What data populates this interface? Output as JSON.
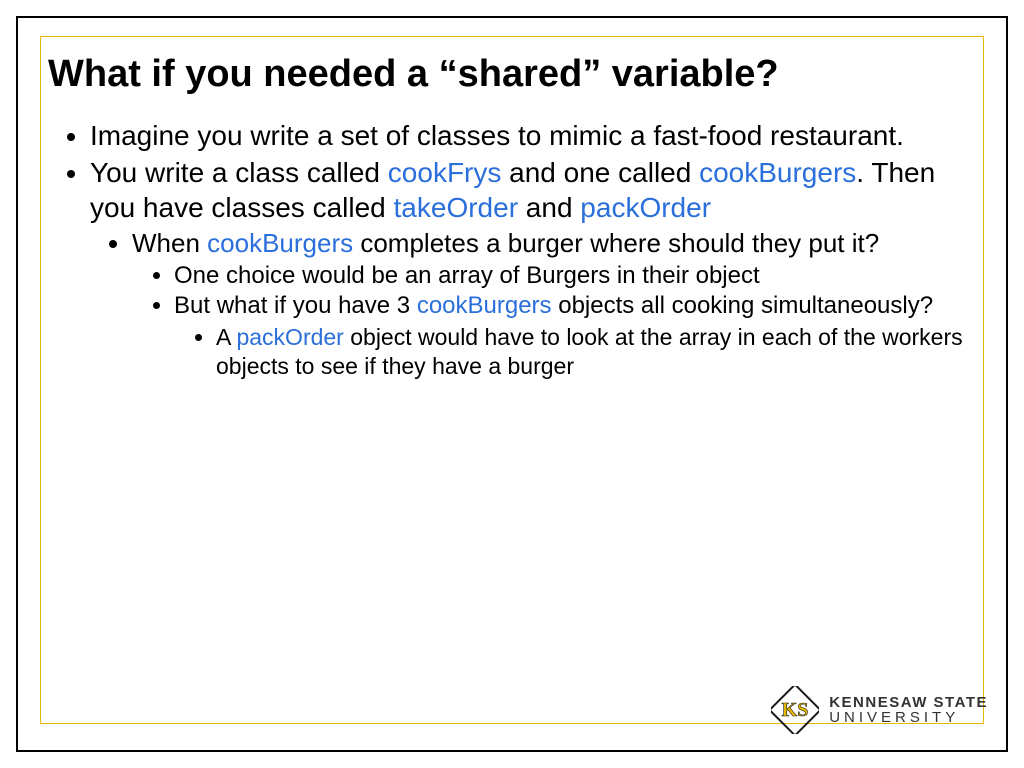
{
  "title": "What if you needed a “shared” variable?",
  "colors": {
    "keyword": "#2a6fdb",
    "accentBorder": "#e6b800"
  },
  "bullets": {
    "b1": "Imagine you write a set of classes to mimic a fast-food restaurant.",
    "b2a": "You write a class called ",
    "b2_kw1": "cookFrys",
    "b2b": " and one called ",
    "b2_kw2": "cookBurgers",
    "b2c": ".  Then you have classes called ",
    "b2_kw3": "takeOrder",
    "b2d": " and ",
    "b2_kw4": "packOrder",
    "b3a": "When ",
    "b3_kw1": "cookBurgers",
    "b3b": " completes a burger where should they put it?",
    "b4": "One choice would be an array of Burgers in their object",
    "b5a": "But what if you have 3 ",
    "b5_kw1": "cookBurgers",
    "b5b": " objects all cooking simultaneously?",
    "b6a": "A ",
    "b6_kw1": "packOrder",
    "b6b": " object would have to look at the array in each of the workers objects to see if they have a burger"
  },
  "logo": {
    "line1": "KENNESAW STATE",
    "line2": "UNIVERSITY"
  }
}
